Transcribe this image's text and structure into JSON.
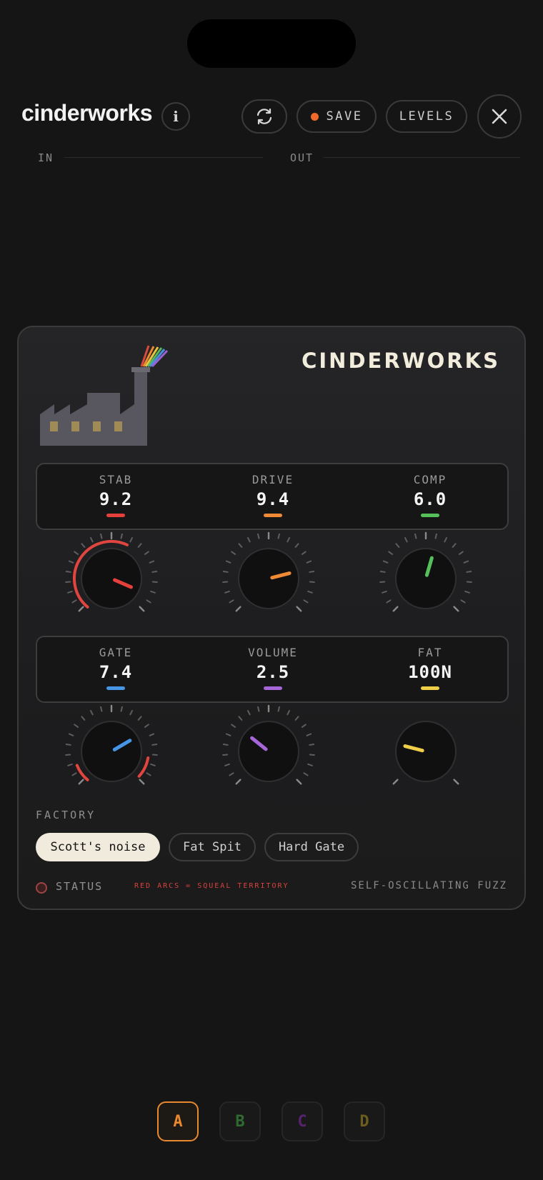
{
  "app": {
    "title": "cinderworks",
    "save_label": "SAVE",
    "levels_label": "LEVELS",
    "icons": {
      "info": "info-icon",
      "sync": "sync-icon",
      "close": "close-icon",
      "save_dot": "recording-dot"
    }
  },
  "meters": {
    "in_label": "IN",
    "out_label": "OUT"
  },
  "device": {
    "brand": "CINDERWORKS",
    "knobs_row1": [
      {
        "label": "STAB",
        "value": "9.2",
        "color": "#e5403c",
        "percent": 0.92
      },
      {
        "label": "DRIVE",
        "value": "9.4",
        "color": "#f08a34",
        "percent": 0.78
      },
      {
        "label": "COMP",
        "value": "6.0",
        "color": "#56c15a",
        "percent": 0.56
      }
    ],
    "knobs_row2": [
      {
        "label": "GATE",
        "value": "7.4",
        "color": "#4795e6",
        "percent": 0.72
      },
      {
        "label": "VOLUME",
        "value": "2.5",
        "color": "#a766d8",
        "percent": 0.31
      },
      {
        "label": "FAT",
        "value": "100N",
        "color": "#efcf47",
        "percent": 0.22
      }
    ],
    "factory_label": "FACTORY",
    "presets": [
      "Scott's noise",
      "Fat Spit",
      "Hard Gate"
    ],
    "status_label": "STATUS",
    "warning": "RED ARCS = SQUEAL TERRITORY",
    "pedal_type": "SELF-OSCILLATING FUZZ"
  },
  "slots": [
    {
      "label": "A",
      "color": "#e8882f",
      "active": true
    },
    {
      "label": "B",
      "color": "#2f6b2f",
      "active": false
    },
    {
      "label": "C",
      "color": "#56246e",
      "active": false
    },
    {
      "label": "D",
      "color": "#6b5d1e",
      "active": false
    }
  ]
}
